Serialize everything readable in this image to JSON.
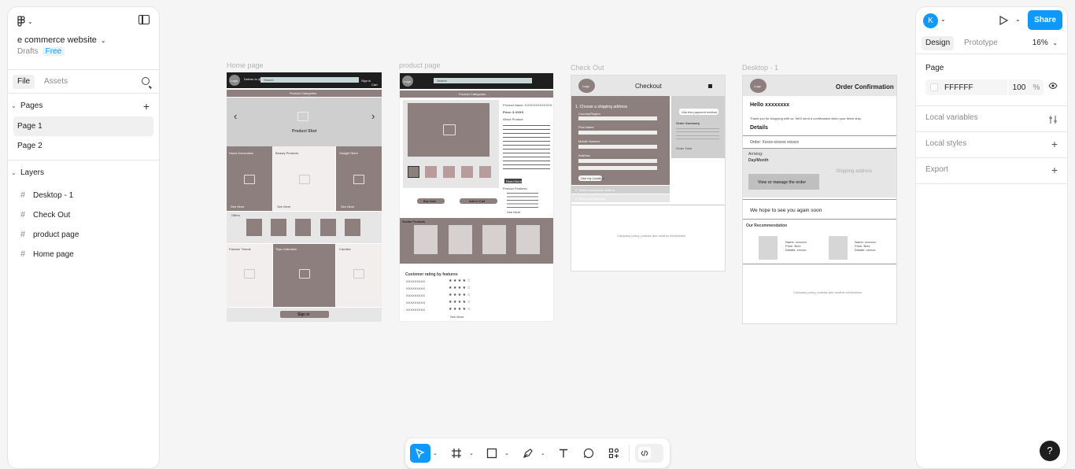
{
  "file": {
    "name": "e commerce website",
    "location": "Drafts",
    "plan": "Free"
  },
  "left_tabs": {
    "file": "File",
    "assets": "Assets"
  },
  "pages": {
    "title": "Pages",
    "items": [
      "Page 1",
      "Page 2"
    ]
  },
  "layers": {
    "title": "Layers",
    "items": [
      "Desktop - 1",
      "Check Out",
      "product page",
      "Home page"
    ]
  },
  "right": {
    "avatar_letter": "K",
    "share": "Share",
    "tabs": {
      "design": "Design",
      "prototype": "Prototype"
    },
    "zoom": "16%",
    "page_section": "Page",
    "page_color": "FFFFFF",
    "page_opacity": "100",
    "percent": "%",
    "local_variables": "Local variables",
    "local_styles": "Local styles",
    "export": "Export"
  },
  "frames": {
    "home": {
      "label": "Home page",
      "logo": "Logo",
      "deliver": "Deliver to\n@ India",
      "search": "Search",
      "signin": "Sign in",
      "cart": "Cart",
      "categories": "Product Categories",
      "product_shot": "Product Shot",
      "tiles_top": [
        "Home Decoration",
        "Beauty Products",
        "Gadget Store"
      ],
      "see_more": "See More",
      "offers": "Offers",
      "tiles_bottom": [
        "Fashion Trends",
        "Toys Collection",
        "Candles"
      ],
      "signin_btn": "Sign in"
    },
    "product": {
      "label": "product page",
      "logo": "Logo",
      "search": "Search",
      "categories": "Product Categories",
      "product_name": "Product Name: XXXXXXXXXXXXX",
      "price": "Price: $ XXXX",
      "about": "About Product:",
      "read_more": "Read More",
      "features": "Product Features",
      "buy_now": "Buy Now",
      "add_to_cart": "Add to Cart",
      "similar": "Similar Products",
      "rating_title": "Customer rating by features",
      "rating_rows": [
        "XXXXXXXXX",
        "XXXXXXXXX",
        "XXXXXXXXX",
        "XXXXXXXXX",
        "XXXXXXXXX"
      ],
      "stars": "★ ★ ★ ★ ☆",
      "see_more": "See More"
    },
    "checkout": {
      "label": "Check Out",
      "logo": "Logo",
      "title": "Checkout",
      "step1": "1. Choose a shipping address",
      "fields": [
        "Country/Region",
        "First Name",
        "Mobile Number",
        "Address"
      ],
      "use_location": "Use my Location",
      "step2": "2. Select a payment method",
      "step3": "3. Items and shipping",
      "use_payment": "Use this payment method",
      "summary": "Order Summary",
      "order_total": "Order Total",
      "footer": "Company policy, policies and another information"
    },
    "desktop": {
      "label": "Desktop - 1",
      "logo": "Logo",
      "title": "Order Confirmation",
      "hello": "Hello xxxxxxxx",
      "thanks": "Thank you for shopping with us. We'll send a confirmation when your items ship.",
      "details": "Details",
      "order": "Order: Xxxxx-xxxxxx xxxxxx",
      "arriving": "Arriving:",
      "day": "Day/Month",
      "manage": "View or manage the order",
      "shipping": "Shipping address",
      "hope": "We hope to see you again soon",
      "recommendation": "Our Recommendation",
      "rec_lines": [
        "Name: xxxxxxx",
        "Price: $xxx",
        "Details: xxxxxx"
      ],
      "footer": "Company policy, policies and another information"
    }
  },
  "colors": {
    "accent": "#0d99ff",
    "wire_dark": "#8c7f7e",
    "wire_mid": "#cfcfcf"
  }
}
